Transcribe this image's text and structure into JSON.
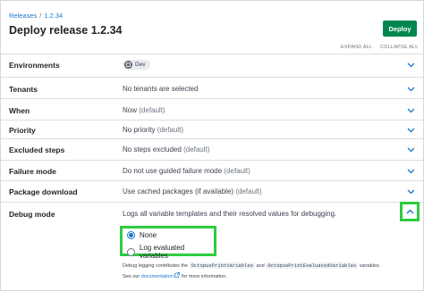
{
  "breadcrumb": {
    "releases": "Releases",
    "separator": "/",
    "version": "1.2.34"
  },
  "title": "Deploy release 1.2.34",
  "deploy_button": "Deploy",
  "expand_all": "EXPAND ALL",
  "collapse_all": "COLLAPSE ALL",
  "rows": [
    {
      "label": "Environments",
      "chip": "Dev"
    },
    {
      "label": "Tenants",
      "value": "No tenants are selected"
    },
    {
      "label": "When",
      "value": "Now",
      "note": "(default)"
    },
    {
      "label": "Priority",
      "value": "No priority",
      "note": "(default)"
    },
    {
      "label": "Excluded steps",
      "value": "No steps excluded",
      "note": "(default)"
    },
    {
      "label": "Failure mode",
      "value": "Do not use guided failure mode",
      "note": "(default)"
    },
    {
      "label": "Package download",
      "value": "Use cached packages (if available)",
      "note": "(default)"
    },
    {
      "label": "Debug mode",
      "value": "Logs all variable templates and their resolved values for debugging."
    }
  ],
  "debug": {
    "options": [
      {
        "label": "None",
        "selected": true
      },
      {
        "label": "Log evaluated variables",
        "selected": false
      }
    ],
    "help_prefix": "Debug logging contributes the",
    "code1": "OctopusPrintVariables",
    "help_and": "and",
    "code2": "OctopusPrintEvaluatedVariables",
    "help_suffix": "variables.",
    "see_our": "See our",
    "doc_link": "documentation",
    "help_end": "for more information."
  },
  "colors": {
    "accent": "#1a77ca",
    "deploy": "#00874d",
    "highlight": "#2ecc40"
  }
}
